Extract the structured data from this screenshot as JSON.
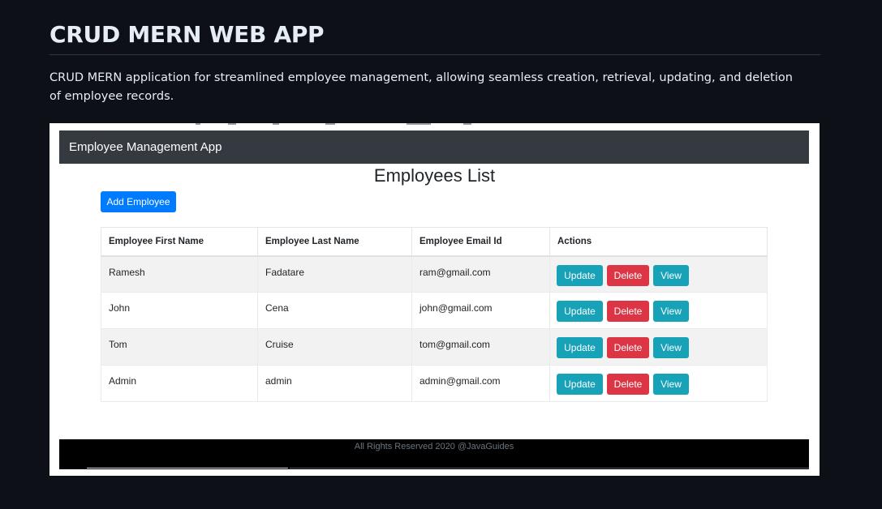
{
  "readme": {
    "title": "CRUD MERN WEB APP",
    "description": "CRUD MERN application for streamlined employee management, allowing seamless creation, retrieval, updating, and deletion of employee records."
  },
  "app": {
    "navbar_brand": "Employee Management App",
    "list_title": "Employees List",
    "add_button": "Add Employee",
    "columns": [
      "Employee First Name",
      "Employee Last Name",
      "Employee Email Id",
      "Actions"
    ],
    "rows": [
      {
        "first": "Ramesh",
        "last": "Fadatare",
        "email": "ram@gmail.com"
      },
      {
        "first": "John",
        "last": "Cena",
        "email": "john@gmail.com"
      },
      {
        "first": "Tom",
        "last": "Cruise",
        "email": "tom@gmail.com"
      },
      {
        "first": "Admin",
        "last": "admin",
        "email": "admin@gmail.com"
      }
    ],
    "actions": {
      "update": "Update",
      "delete": "Delete",
      "view": "View"
    },
    "footer": "All Rights Reserved 2020 @JavaGuides"
  },
  "colors": {
    "page_background": "#0d1117",
    "navbar": "#343a40",
    "primary": "#007bff",
    "info": "#17a2b8",
    "danger": "#dc3545",
    "footer": "#000000"
  }
}
